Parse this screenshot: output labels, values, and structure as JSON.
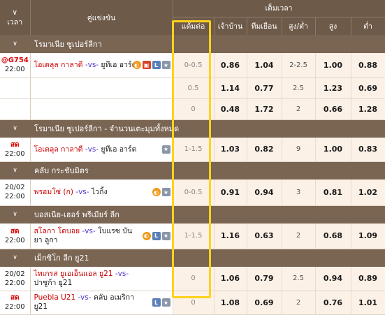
{
  "header": {
    "time_label": "เวลา",
    "match_label": "คู่แข่งขัน",
    "fulltime_label": "เต็มเวลา",
    "handicap_label": "แต้มต่อ",
    "home_label": "เจ้าบ้าน",
    "away_label": "ทีมเยือน",
    "ou_label": "สูง/ต่ำ",
    "over_label": "สูง",
    "under_label": "ต่ำ",
    "chevron": "∨"
  },
  "leagues": [
    {
      "name": "โรมาเนีย ซูเปอร์ลีกา",
      "rows": [
        {
          "time1": "@G754",
          "time2": "22:00",
          "home": "โอเตลุล กาลาดี",
          "vs": "-vs-",
          "away": "ยูทีเอ อาร์ด",
          "icons": [
            "orange",
            "red",
            "blue",
            "grey"
          ],
          "hcp": "0-0.5",
          "h": "0.86",
          "a": "1.04",
          "ou": "2-2.5",
          "over": "1.00",
          "under": "0.88"
        },
        {
          "time1": "",
          "time2": "",
          "home": "",
          "vs": "",
          "away": "",
          "icons": [],
          "hcp": "0.5",
          "h": "1.14",
          "a": "0.77",
          "ou": "2.5",
          "over": "1.23",
          "under": "0.69"
        },
        {
          "time1": "",
          "time2": "",
          "home": "",
          "vs": "",
          "away": "",
          "icons": [],
          "hcp": "0",
          "h": "0.48",
          "a": "1.72",
          "ou": "2",
          "over": "0.66",
          "under": "1.28"
        }
      ]
    },
    {
      "name": "โรมาเนีย ซูเปอร์ลีกา - จำนวนเตะมุมทั้งหมด",
      "rows": [
        {
          "time1": "สด",
          "time2": "22:00",
          "home": "โอเตลุล กาลาดี",
          "vs": "-vs-",
          "away": "ยูทีเอ อาร์ด",
          "icons": [
            "grey"
          ],
          "hcp": "1-1.5",
          "h": "1.03",
          "a": "0.82",
          "ou": "9",
          "over": "1.00",
          "under": "0.83"
        }
      ]
    },
    {
      "name": "คลับ กระชับมิตร",
      "rows": [
        {
          "time1": "20/02",
          "time2": "22:00",
          "home": "พรอมโซ่ (ก)",
          "vs": "-vs-",
          "away": "ไวกิ้ง",
          "icons": [
            "orange",
            "grey"
          ],
          "hcp": "0-0.5",
          "h": "0.91",
          "a": "0.94",
          "ou": "3",
          "over": "0.81",
          "under": "1.02"
        }
      ]
    },
    {
      "name": "บอสเนีย-เฮอร์ พรีเมียร์ ลีก",
      "rows": [
        {
          "time1": "สด",
          "time2": "22:00",
          "home": "สโลกา โดบอย",
          "vs": "-vs-",
          "away": "โบแรซ บันยา ลูกา",
          "icons": [
            "orange",
            "blue",
            "grey"
          ],
          "hcp": "1-1.5",
          "h": "1.16",
          "a": "0.63",
          "ou": "2",
          "over": "0.68",
          "under": "1.09"
        }
      ]
    },
    {
      "name": "เม็กซิโก ลีก ยู21",
      "rows": [
        {
          "time1": "20/02",
          "time2": "22:00",
          "home": "ไทเกรส ยูเอเอ็นแอล ยู21",
          "vs": "-vs-",
          "away": "ปาชูก้า ยู21",
          "icons": [],
          "hcp": "0",
          "h": "1.06",
          "a": "0.79",
          "ou": "2.5",
          "over": "0.94",
          "under": "0.89"
        },
        {
          "time1": "สด",
          "time2": "22:00",
          "home": "Puebla U21",
          "vs": "-vs-",
          "away": "คลับ อเมริกา ยู21",
          "icons": [
            "blue",
            "grey"
          ],
          "hcp": "0",
          "h": "1.08",
          "a": "0.69",
          "ou": "2",
          "over": "0.76",
          "under": "1.01"
        }
      ]
    }
  ],
  "icon_glyphs": {
    "orange": "◐",
    "red": "▣",
    "blue": "L",
    "grey": "★"
  },
  "colors": {
    "header": "#6e5a48",
    "league": "#7a6553",
    "live": "#d40000",
    "highlight": "#ffd21c"
  }
}
